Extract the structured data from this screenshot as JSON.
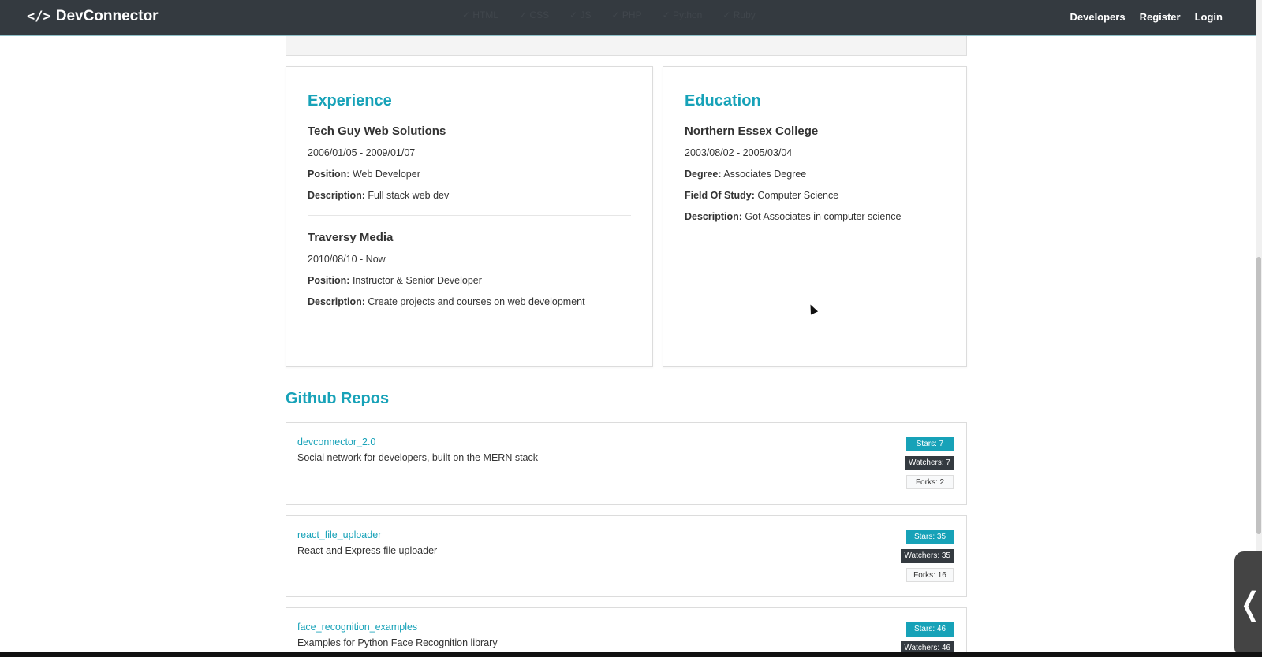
{
  "navbar": {
    "brand_icon": "</>",
    "brand": "DevConnector",
    "skills": [
      "✓ HTML",
      "✓ CSS",
      "✓ JS",
      "✓ PHP",
      "✓ Python",
      "✓ Ruby"
    ],
    "links": [
      "Developers",
      "Register",
      "Login"
    ]
  },
  "experience": {
    "title": "Experience",
    "entries": [
      {
        "company": "Tech Guy Web Solutions",
        "dates": "2006/01/05 - 2009/01/07",
        "position_label": "Position:",
        "position": "Web Developer",
        "description_label": "Description:",
        "description": "Full stack web dev"
      },
      {
        "company": "Traversy Media",
        "dates": "2010/08/10 - Now",
        "position_label": "Position:",
        "position": "Instructor & Senior Developer",
        "description_label": "Description:",
        "description": "Create projects and courses on web development"
      }
    ]
  },
  "education": {
    "title": "Education",
    "entries": [
      {
        "school": "Northern Essex College",
        "dates": "2003/08/02 - 2005/03/04",
        "degree_label": "Degree:",
        "degree": "Associates Degree",
        "field_label": "Field Of Study:",
        "field": "Computer Science",
        "description_label": "Description:",
        "description": "Got Associates in computer science"
      }
    ]
  },
  "github": {
    "title": "Github Repos",
    "repos": [
      {
        "name": "devconnector_2.0",
        "description": "Social network for developers, built on the MERN stack",
        "stars": "Stars: 7",
        "watchers": "Watchers: 7",
        "forks": "Forks: 2"
      },
      {
        "name": "react_file_uploader",
        "description": "React and Express file uploader",
        "stars": "Stars: 35",
        "watchers": "Watchers: 35",
        "forks": "Forks: 16"
      },
      {
        "name": "face_recognition_examples",
        "description": "Examples for Python Face Recognition library",
        "stars": "Stars: 46",
        "watchers": "Watchers: 46",
        "forks": ""
      }
    ]
  },
  "ui": {
    "side_toggle": "❬",
    "accent_color": "#17a2b8",
    "navbar_color": "#343a40"
  }
}
